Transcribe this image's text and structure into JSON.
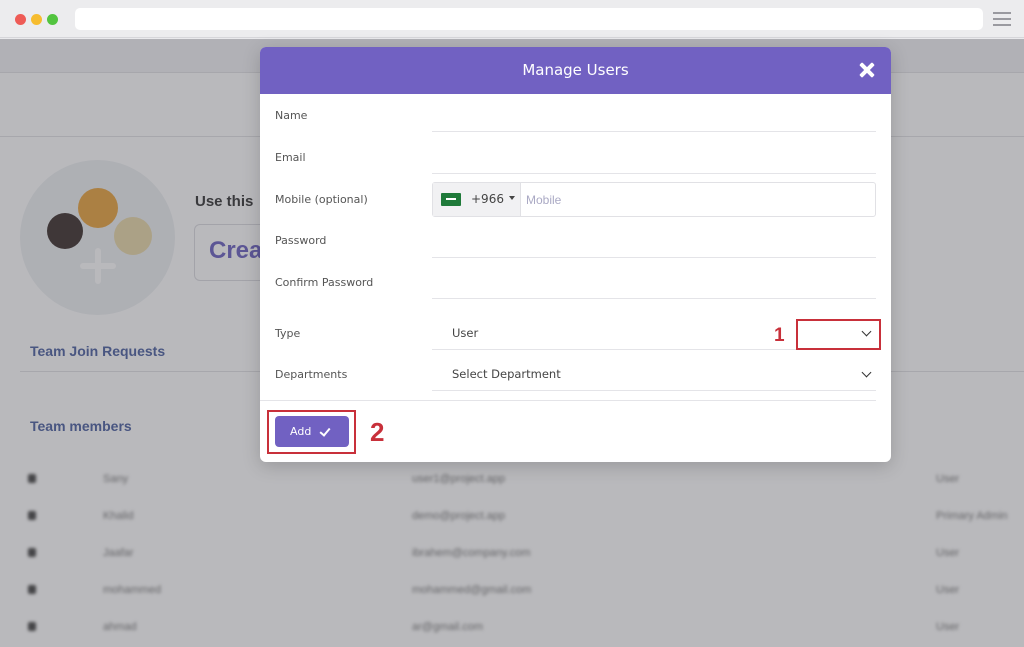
{
  "background": {
    "banner_text": "Use this",
    "create_text": "Crea",
    "section_requests": "Team Join Requests",
    "section_members": "Team members",
    "members": [
      {
        "name": "Sany",
        "email": "user1@project.app",
        "type": "User"
      },
      {
        "name": "Khalid",
        "email": "demo@project.app",
        "type": "Primary Admin"
      },
      {
        "name": "Jaafar",
        "email": "ibrahem@company.com",
        "type": "User"
      },
      {
        "name": "mohammed",
        "email": "mohammed@gmail.com",
        "type": "User"
      },
      {
        "name": "ahmad",
        "email": "ar@gmail.com",
        "type": "User"
      }
    ]
  },
  "modal": {
    "title": "Manage Users",
    "fields": {
      "name_label": "Name",
      "email_label": "Email",
      "mobile_label": "Mobile (optional)",
      "mobile_dial_code": "+966",
      "mobile_placeholder": "Mobile",
      "password_label": "Password",
      "confirm_password_label": "Confirm Password",
      "type_label": "Type",
      "type_value": "User",
      "departments_label": "Departments",
      "departments_value": "Select Department"
    },
    "add_label": "Add"
  },
  "annotations": {
    "one": "1",
    "two": "2"
  },
  "colors": {
    "accent": "#7161c2",
    "annotation": "#c8303a"
  }
}
